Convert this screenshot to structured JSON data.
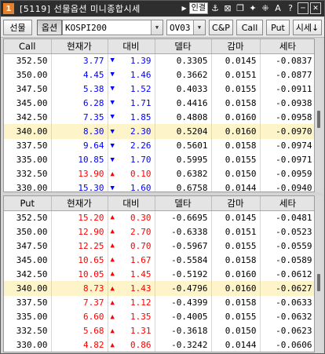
{
  "titlebar": {
    "number": "1",
    "title": "[5119] 선물옵션 미니종합시세",
    "link_label": "인결",
    "tools": [
      "⚓",
      "⊠",
      "❐",
      "✦",
      "⁜",
      "A",
      "?",
      "─",
      "✕"
    ]
  },
  "toolbar": {
    "futures_label": "선물",
    "options_label": "옵션",
    "underlying": "KOSPI200",
    "expiry": "OV03",
    "cp_label": "C&P",
    "call_label": "Call",
    "put_label": "Put",
    "quote_label": "시세↓"
  },
  "call_table": {
    "headers": [
      "Call",
      "현재가",
      "대비",
      "델타",
      "감마",
      "세타"
    ],
    "rows": [
      {
        "strike": "352.50",
        "price": "3.77",
        "dir": "down",
        "change": "1.39",
        "delta": "0.3305",
        "gamma": "0.0145",
        "theta": "-0.0837"
      },
      {
        "strike": "350.00",
        "price": "4.45",
        "dir": "down",
        "change": "1.46",
        "delta": "0.3662",
        "gamma": "0.0151",
        "theta": "-0.0877"
      },
      {
        "strike": "347.50",
        "price": "5.38",
        "dir": "down",
        "change": "1.52",
        "delta": "0.4033",
        "gamma": "0.0155",
        "theta": "-0.0911"
      },
      {
        "strike": "345.00",
        "price": "6.28",
        "dir": "down",
        "change": "1.71",
        "delta": "0.4416",
        "gamma": "0.0158",
        "theta": "-0.0938"
      },
      {
        "strike": "342.50",
        "price": "7.35",
        "dir": "down",
        "change": "1.85",
        "delta": "0.4808",
        "gamma": "0.0160",
        "theta": "-0.0958"
      },
      {
        "strike": "340.00",
        "price": "8.30",
        "dir": "down",
        "change": "2.30",
        "delta": "0.5204",
        "gamma": "0.0160",
        "theta": "-0.0970",
        "highlight": true
      },
      {
        "strike": "337.50",
        "price": "9.64",
        "dir": "down",
        "change": "2.26",
        "delta": "0.5601",
        "gamma": "0.0158",
        "theta": "-0.0974"
      },
      {
        "strike": "335.00",
        "price": "10.85",
        "dir": "down",
        "change": "1.70",
        "delta": "0.5995",
        "gamma": "0.0155",
        "theta": "-0.0971"
      },
      {
        "strike": "332.50",
        "price": "13.90",
        "dir": "up",
        "change": "0.10",
        "delta": "0.6382",
        "gamma": "0.0150",
        "theta": "-0.0959"
      },
      {
        "strike": "330.00",
        "price": "15.30",
        "dir": "down",
        "change": "1.60",
        "delta": "0.6758",
        "gamma": "0.0144",
        "theta": "-0.0940"
      }
    ]
  },
  "put_table": {
    "headers": [
      "Put",
      "현재가",
      "대비",
      "델타",
      "감마",
      "세타"
    ],
    "rows": [
      {
        "strike": "352.50",
        "price": "15.20",
        "dir": "up",
        "change": "0.30",
        "delta": "-0.6695",
        "gamma": "0.0145",
        "theta": "-0.0481"
      },
      {
        "strike": "350.00",
        "price": "12.90",
        "dir": "up",
        "change": "2.70",
        "delta": "-0.6338",
        "gamma": "0.0151",
        "theta": "-0.0523"
      },
      {
        "strike": "347.50",
        "price": "12.25",
        "dir": "up",
        "change": "0.70",
        "delta": "-0.5967",
        "gamma": "0.0155",
        "theta": "-0.0559"
      },
      {
        "strike": "345.00",
        "price": "10.65",
        "dir": "up",
        "change": "1.67",
        "delta": "-0.5584",
        "gamma": "0.0158",
        "theta": "-0.0589"
      },
      {
        "strike": "342.50",
        "price": "10.05",
        "dir": "up",
        "change": "1.45",
        "delta": "-0.5192",
        "gamma": "0.0160",
        "theta": "-0.0612"
      },
      {
        "strike": "340.00",
        "price": "8.73",
        "dir": "up",
        "change": "1.43",
        "delta": "-0.4796",
        "gamma": "0.0160",
        "theta": "-0.0627",
        "highlight": true
      },
      {
        "strike": "337.50",
        "price": "7.37",
        "dir": "up",
        "change": "1.12",
        "delta": "-0.4399",
        "gamma": "0.0158",
        "theta": "-0.0633"
      },
      {
        "strike": "335.00",
        "price": "6.60",
        "dir": "up",
        "change": "1.35",
        "delta": "-0.4005",
        "gamma": "0.0155",
        "theta": "-0.0632"
      },
      {
        "strike": "332.50",
        "price": "5.68",
        "dir": "up",
        "change": "1.31",
        "delta": "-0.3618",
        "gamma": "0.0150",
        "theta": "-0.0623"
      },
      {
        "strike": "330.00",
        "price": "4.82",
        "dir": "up",
        "change": "0.86",
        "delta": "-0.3242",
        "gamma": "0.0144",
        "theta": "-0.0606"
      }
    ]
  },
  "colors": {
    "up": "#ff0000",
    "down": "#0000ff",
    "highlight_row": "#fdf4ca",
    "title_badge": "#e6822d"
  },
  "icons": {
    "up": "up-triangle-icon",
    "down": "down-triangle-icon"
  }
}
